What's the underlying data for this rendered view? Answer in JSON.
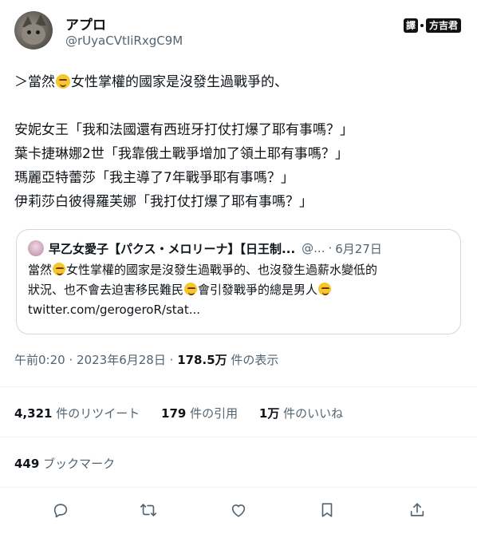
{
  "author": {
    "display_name": "アプロ",
    "handle": "@rUyaCVtIiRxgC9M"
  },
  "watermark": {
    "label": "譯",
    "name": "方吉君"
  },
  "tweet": {
    "line1_a": "＞當然",
    "line1_b": "女性掌權的國家是沒發生過戰爭的、",
    "lines": [
      "安妮女王「我和法國還有西班牙打仗打爆了耶有事嗎？」",
      "葉卡捷琳娜2世「我靠俄土戰爭增加了領土耶有事嗎？」",
      "瑪麗亞特蕾莎「我主導了7年戰爭耶有事嗎？」",
      "伊莉莎白彼得羅芙娜「我打仗打爆了耶有事嗎？」"
    ]
  },
  "quote": {
    "name": "早乙女愛子【パクス・メロリーナ】【日王制...",
    "handle": "@...",
    "dot": "·",
    "date": "6月27日",
    "line1_a": "當然",
    "line1_b": "女性掌權的國家是沒發生過戰爭的、也沒發生過薪水變低的",
    "line2_a": "狀況、也不會去迫害移民難民",
    "line2_b": "會引發戰爭的總是男人",
    "line3": "twitter.com/gerogeroR/stat..."
  },
  "meta": {
    "time": "午前0:20",
    "sep": "·",
    "date": "2023年6月28日",
    "sep2": "·",
    "views_num": "178.5万",
    "views_label": "件の表示"
  },
  "stats": {
    "retweets_num": "4,321",
    "retweets_label": "件のリツイート",
    "quotes_num": "179",
    "quotes_label": "件の引用",
    "likes_num": "1万",
    "likes_label": "件のいいね",
    "bookmarks_num": "449",
    "bookmarks_label": "ブックマーク"
  },
  "icons": {
    "reply": "reply-icon",
    "retweet": "retweet-icon",
    "like": "heart-icon",
    "bookmark": "bookmark-icon",
    "share": "share-icon"
  },
  "colors": {
    "text": "#0f1419",
    "secondary": "#536471",
    "border": "#cfd9de",
    "emoji": "#f7c62d"
  }
}
